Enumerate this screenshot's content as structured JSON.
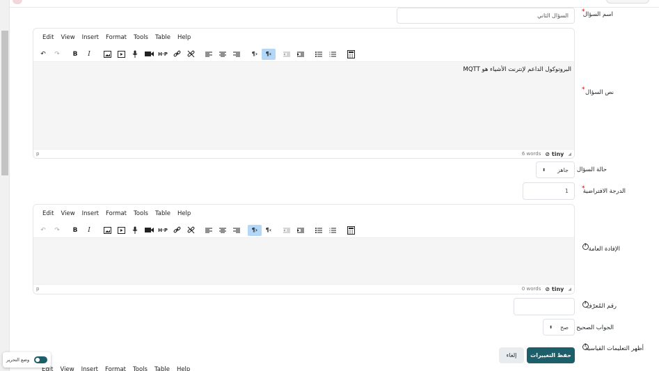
{
  "fields": {
    "question_name": {
      "label": "اسم السؤال",
      "value": "السؤال الثاني"
    },
    "question_text": {
      "label": "نص السؤال",
      "content": "البروتوكول الداعم لإنترنت الأشياء هو MQTT",
      "status_path": "p",
      "word_count": "6 words"
    },
    "question_status": {
      "label": "حالة السؤال",
      "value": "جاهز"
    },
    "default_mark": {
      "label": "الدرجة الافتراضية",
      "value": "1"
    },
    "general_feedback": {
      "label": "الإفادة العامة",
      "content": "",
      "status_path": "p",
      "word_count": "0 words"
    },
    "id_number": {
      "label": "رقم المُعرّف",
      "value": ""
    },
    "correct_answer": {
      "label": "الجواب الصحيح",
      "value": "صح"
    },
    "show_standard_instructions": {
      "label": "أظهر التعليمات القياسية"
    }
  },
  "editor": {
    "menu": [
      "Edit",
      "View",
      "Insert",
      "Format",
      "Tools",
      "Table",
      "Help"
    ],
    "brand": "tiny"
  },
  "buttons": {
    "save": "حفظ التغييرات",
    "cancel": "إلغاء"
  },
  "edit_mode_toggle": {
    "label": "وضع التحرير",
    "on": true
  },
  "colors": {
    "primary": "#1d5e6b",
    "required": "#cc0000",
    "toolbar_active": "#b4d7f7"
  }
}
